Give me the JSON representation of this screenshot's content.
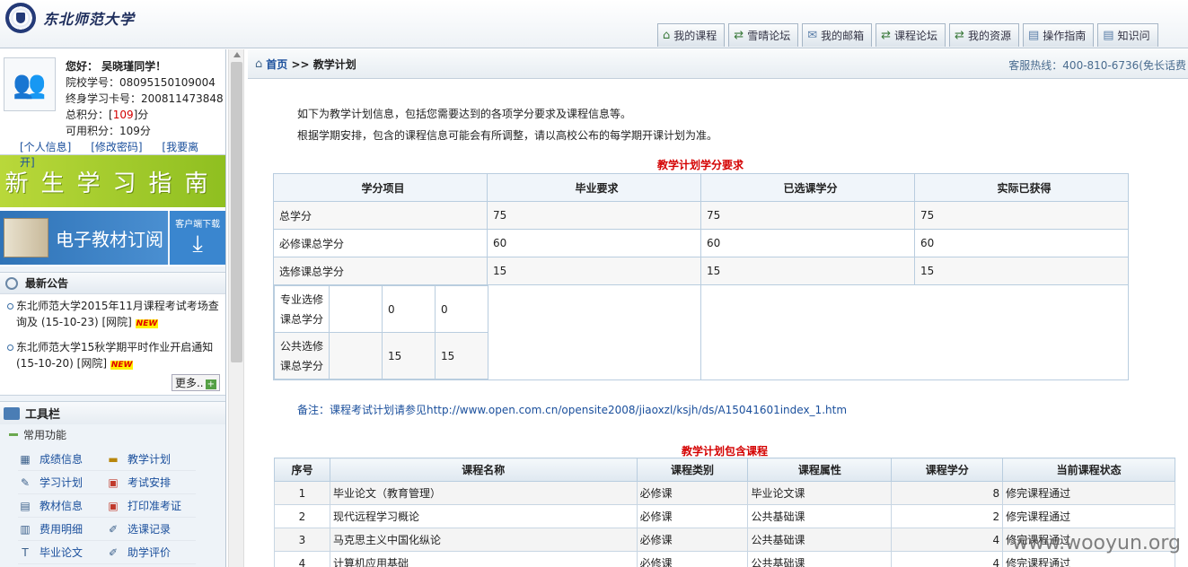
{
  "header": {
    "logo_text": "东北师范大学",
    "tabs": [
      {
        "label": "我的课程",
        "icon": "home-icon"
      },
      {
        "label": "雪晴论坛",
        "icon": "forum-icon"
      },
      {
        "label": "我的邮箱",
        "icon": "mail-icon"
      },
      {
        "label": "课程论坛",
        "icon": "forum-icon"
      },
      {
        "label": "我的资源",
        "icon": "resource-icon"
      },
      {
        "label": "操作指南",
        "icon": "guide-icon"
      },
      {
        "label": "知识问",
        "icon": "knowledge-icon"
      }
    ]
  },
  "user": {
    "greeting": "您好： 吴晓瑾同学！",
    "school_id": "院校学号：08095150109004",
    "lifelong_id": "终身学习卡号：200811473848",
    "total_points_prefix": "总积分：[",
    "total_points_value": "109",
    "total_points_suffix": "]分",
    "available_points": "可用积分：109分",
    "links": [
      "[个人信息]",
      "[修改密码]",
      "[我要离开]"
    ]
  },
  "banners": {
    "guide": "新生学习指南",
    "textbook": "电子教材订阅",
    "client_download": "客户端下载"
  },
  "notices": {
    "title": "最新公告",
    "items": [
      {
        "text": "东北师范大学2015年11月课程考试考场查询及 (15-10-23) [网院]",
        "badge": "NEW"
      },
      {
        "text": "东北师范大学15秋学期平时作业开启通知 (15-10-20) [网院]",
        "badge": "NEW"
      }
    ],
    "more": "更多.."
  },
  "toolbar": {
    "title": "工具栏",
    "section": "常用功能",
    "items": [
      {
        "label": "成绩信息",
        "icon": "grade-icon"
      },
      {
        "label": "教学计划",
        "icon": "plan-icon"
      },
      {
        "label": "学习计划",
        "icon": "study-plan-icon"
      },
      {
        "label": "考试安排",
        "icon": "exam-icon"
      },
      {
        "label": "教材信息",
        "icon": "book-icon"
      },
      {
        "label": "打印准考证",
        "icon": "print-icon"
      },
      {
        "label": "费用明细",
        "icon": "fee-icon"
      },
      {
        "label": "选课记录",
        "icon": "record-icon"
      },
      {
        "label": "毕业论文",
        "icon": "thesis-icon"
      },
      {
        "label": "助学评价",
        "icon": "evaluate-icon"
      }
    ]
  },
  "breadcrumb": {
    "home": "首页",
    "sep": " >> ",
    "current": "教学计划",
    "hotline": "客服热线：400-810-6736(免长话费"
  },
  "intro": {
    "line1": "如下为教学计划信息，包括您需要达到的各项学分要求及课程信息等。",
    "line2": "根据学期安排，包含的课程信息可能会有所调整，请以高校公布的每学期开课计划为准。"
  },
  "credits": {
    "caption": "教学计划学分要求",
    "headers": [
      "学分项目",
      "毕业要求",
      "已选课学分",
      "实际已获得"
    ],
    "rows": [
      [
        "总学分",
        "75",
        "75",
        "75"
      ],
      [
        "必修课总学分",
        "60",
        "60",
        "60"
      ],
      [
        "选修课总学分",
        "15",
        "15",
        "15"
      ]
    ],
    "sub_rows": [
      [
        "专业选修课总学分",
        "",
        "0",
        "0"
      ],
      [
        "公共选修课总学分",
        "",
        "15",
        "15"
      ]
    ]
  },
  "note": "备注：课程考试计划请参见http://www.open.com.cn/opensite2008/jiaoxzl/ksjh/ds/A15041601index_1.htm",
  "courses": {
    "caption": "教学计划包含课程",
    "headers": [
      "序号",
      "课程名称",
      "课程类别",
      "课程属性",
      "课程学分",
      "当前课程状态"
    ],
    "rows": [
      [
        "1",
        "毕业论文（教育管理）",
        "必修课",
        "毕业论文课",
        "8",
        "修完课程通过"
      ],
      [
        "2",
        "现代远程学习概论",
        "必修课",
        "公共基础课",
        "2",
        "修完课程通过"
      ],
      [
        "3",
        "马克思主义中国化纵论",
        "必修课",
        "公共基础课",
        "4",
        "修完课程通过"
      ],
      [
        "4",
        "计算机应用基础",
        "必修课",
        "公共基础课",
        "4",
        "修完课程通过"
      ]
    ]
  },
  "watermark": "www.wooyun.org"
}
